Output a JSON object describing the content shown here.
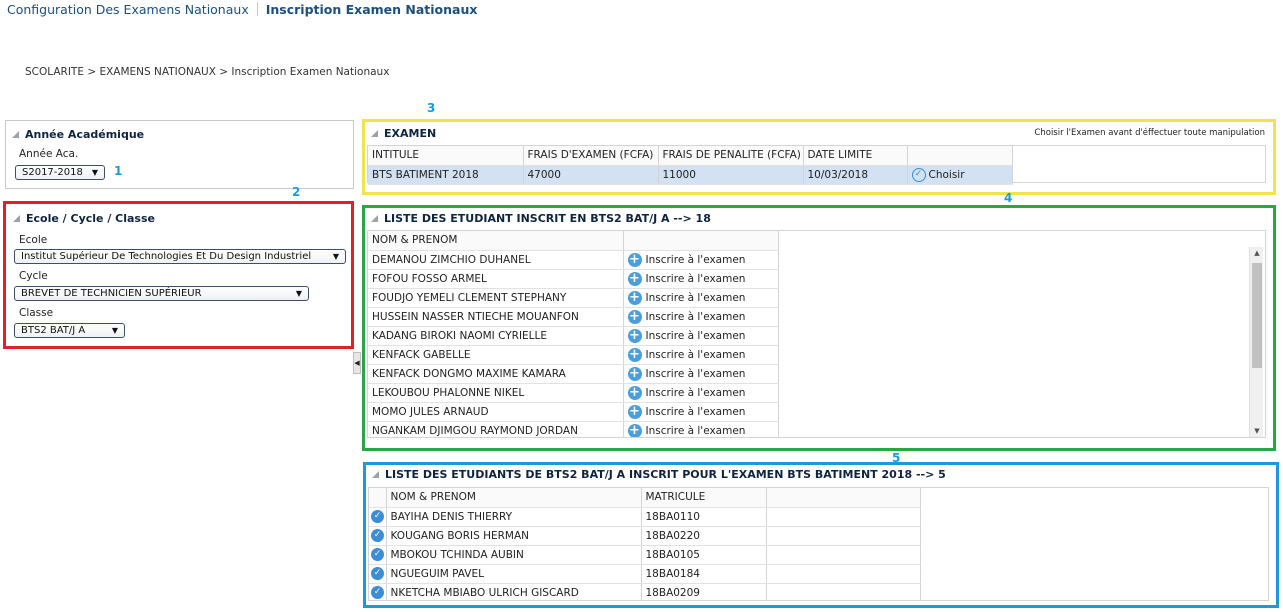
{
  "header": {
    "app_title": "Configuration Des Examens Nationaux",
    "page_title": "Inscription Examen Nationaux"
  },
  "breadcrumb": "SCOLARITE > EXAMENS NATIONAUX > Inscription Examen Nationaux",
  "annotations": {
    "n1": "1",
    "n2": "2",
    "n3": "3",
    "n4": "4",
    "n5": "5"
  },
  "annotation_colors": {
    "frame2": "#e0202a",
    "frame3": "#f2e34a",
    "frame4": "#27a844",
    "frame5": "#1a9bd7",
    "numbers": "#1a9bd7"
  },
  "annee_panel": {
    "title": "Année Académique",
    "label": "Année Aca.",
    "selected": "S2017-2018"
  },
  "ecole_panel": {
    "title": "Ecole / Cycle / Classe",
    "ecole_label": "Ecole",
    "ecole_value": "Institut Supérieur De Technologies Et Du Design Industriel",
    "cycle_label": "Cycle",
    "cycle_value": "BREVET DE TECHNICIEN SUPÉRIEUR",
    "classe_label": "Classe",
    "classe_value": "BTS2 BAT/J A"
  },
  "examen_panel": {
    "title": "EXAMEN",
    "hint": "Choisir l'Examen avant d'éffectuer toute manipulation",
    "columns": [
      "INTITULE",
      "FRAIS D'EXAMEN (FCFA)",
      "FRAIS DE PENALITE (FCFA)",
      "DATE LIMITE"
    ],
    "row": {
      "intitule": "BTS BATIMENT 2018",
      "frais_examen": "47000",
      "frais_penalite": "11000",
      "date_limite": "10/03/2018",
      "action": "Choisir"
    }
  },
  "inscrits_panel": {
    "title": "LISTE DES ETUDIANT INSCRIT EN BTS2 BAT/J A --> 18",
    "column": "NOM & PRENOM",
    "action_label": "Inscrire à l'examen",
    "students": [
      "DEMANOU ZIMCHIO DUHANEL",
      "FOFOU FOSSO ARMEL",
      "FOUDJO YEMELI CLEMENT STEPHANY",
      "HUSSEIN NASSER NTIECHE MOUANFON",
      "KADANG BIROKI NAOMI CYRIELLE",
      "KENFACK GABELLE",
      "KENFACK DONGMO MAXIME KAMARA",
      "LEKOUBOU PHALONNE NIKEL",
      "MOMO JULES ARNAUD",
      "NGANKAM DJIMGOU RAYMOND JORDAN"
    ]
  },
  "examen_inscrits_panel": {
    "title": "LISTE DES ETUDIANTS DE BTS2 BAT/J A INSCRIT POUR L'EXAMEN BTS BATIMENT 2018 --> 5",
    "columns": [
      "NOM & PRENOM",
      "MATRICULE"
    ],
    "rows": [
      {
        "nom": "BAYIHA DENIS THIERRY",
        "matricule": "18BA0110"
      },
      {
        "nom": "KOUGANG BORIS HERMAN",
        "matricule": "18BA0220"
      },
      {
        "nom": "MBOKOU TCHINDA AUBIN",
        "matricule": "18BA0105"
      },
      {
        "nom": "NGUEGUIM PAVEL",
        "matricule": "18BA0184"
      },
      {
        "nom": "NKETCHA MBIABO ULRICH GISCARD",
        "matricule": "18BA0209"
      }
    ]
  }
}
